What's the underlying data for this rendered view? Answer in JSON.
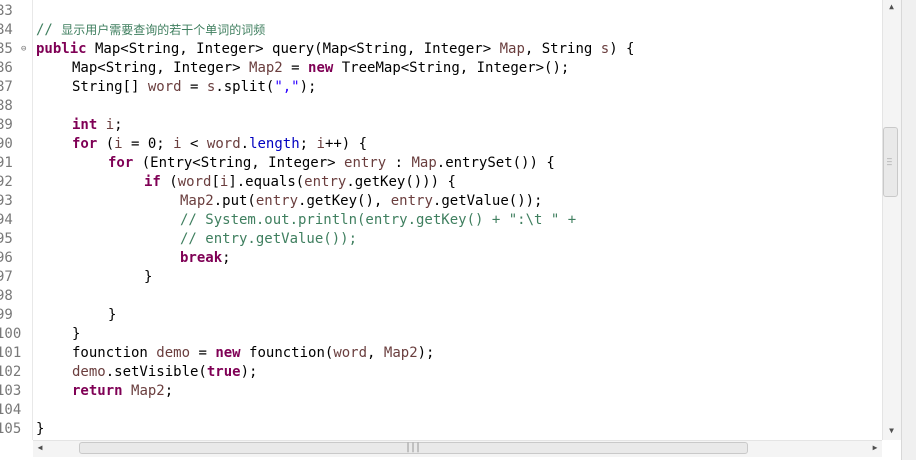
{
  "gutter": {
    "line_numbers": [
      "83",
      "84",
      "85",
      "86",
      "87",
      "88",
      "89",
      "90",
      "91",
      "92",
      "93",
      "94",
      "95",
      "96",
      "97",
      "98",
      "99",
      "100",
      "101",
      "102",
      "103",
      "104",
      "105"
    ],
    "fold_marker_line": 2
  },
  "code": {
    "lines": [
      {
        "indent": 0,
        "tokens": []
      },
      {
        "indent": 0,
        "tokens": [
          {
            "t": "// ",
            "c": "cm"
          },
          {
            "t": "显示用户需要查询的若干个单词的词频",
            "c": "cm cm-cn"
          }
        ]
      },
      {
        "indent": 0,
        "tokens": [
          {
            "t": "public",
            "c": "kw"
          },
          {
            "t": " Map<String, Integer> query(Map<String, Integer> "
          },
          {
            "t": "Map",
            "c": "lv"
          },
          {
            "t": ", String "
          },
          {
            "t": "s",
            "c": "lv"
          },
          {
            "t": ") {"
          }
        ]
      },
      {
        "indent": 1,
        "tokens": [
          {
            "t": "Map<String, Integer> "
          },
          {
            "t": "Map2",
            "c": "lv"
          },
          {
            "t": " = "
          },
          {
            "t": "new",
            "c": "kw"
          },
          {
            "t": " TreeMap<String, Integer>();"
          }
        ]
      },
      {
        "indent": 1,
        "tokens": [
          {
            "t": "String[] "
          },
          {
            "t": "word",
            "c": "lv"
          },
          {
            "t": " = "
          },
          {
            "t": "s",
            "c": "lv"
          },
          {
            "t": ".split("
          },
          {
            "t": "\",\"",
            "c": "str"
          },
          {
            "t": ");"
          }
        ]
      },
      {
        "indent": 0,
        "tokens": []
      },
      {
        "indent": 1,
        "tokens": [
          {
            "t": "int",
            "c": "kw"
          },
          {
            "t": " "
          },
          {
            "t": "i",
            "c": "lv"
          },
          {
            "t": ";"
          }
        ]
      },
      {
        "indent": 1,
        "tokens": [
          {
            "t": "for",
            "c": "kw"
          },
          {
            "t": " ("
          },
          {
            "t": "i",
            "c": "lv"
          },
          {
            "t": " = 0; "
          },
          {
            "t": "i",
            "c": "lv"
          },
          {
            "t": " < "
          },
          {
            "t": "word",
            "c": "lv"
          },
          {
            "t": "."
          },
          {
            "t": "length",
            "c": "fld"
          },
          {
            "t": "; "
          },
          {
            "t": "i",
            "c": "lv"
          },
          {
            "t": "++) {"
          }
        ]
      },
      {
        "indent": 2,
        "tokens": [
          {
            "t": "for",
            "c": "kw"
          },
          {
            "t": " (Entry<String, Integer> "
          },
          {
            "t": "entry",
            "c": "lv"
          },
          {
            "t": " : "
          },
          {
            "t": "Map",
            "c": "lv"
          },
          {
            "t": ".entrySet()) {"
          }
        ]
      },
      {
        "indent": 3,
        "tokens": [
          {
            "t": "if",
            "c": "kw"
          },
          {
            "t": " ("
          },
          {
            "t": "word",
            "c": "lv"
          },
          {
            "t": "["
          },
          {
            "t": "i",
            "c": "lv"
          },
          {
            "t": "].equals("
          },
          {
            "t": "entry",
            "c": "lv"
          },
          {
            "t": ".getKey())) {"
          }
        ]
      },
      {
        "indent": 4,
        "tokens": [
          {
            "t": "Map2",
            "c": "lv"
          },
          {
            "t": ".put("
          },
          {
            "t": "entry",
            "c": "lv"
          },
          {
            "t": ".getKey(), "
          },
          {
            "t": "entry",
            "c": "lv"
          },
          {
            "t": ".getValue());"
          }
        ]
      },
      {
        "indent": 4,
        "tokens": [
          {
            "t": "// System.out.println(entry.getKey() + \":\\t \" +",
            "c": "cm"
          }
        ]
      },
      {
        "indent": 4,
        "tokens": [
          {
            "t": "// entry.getValue());",
            "c": "cm"
          }
        ]
      },
      {
        "indent": 4,
        "tokens": [
          {
            "t": "break",
            "c": "kw"
          },
          {
            "t": ";"
          }
        ]
      },
      {
        "indent": 3,
        "tokens": [
          {
            "t": "}"
          }
        ]
      },
      {
        "indent": 0,
        "tokens": []
      },
      {
        "indent": 2,
        "tokens": [
          {
            "t": "}"
          }
        ]
      },
      {
        "indent": 1,
        "tokens": [
          {
            "t": "}"
          }
        ]
      },
      {
        "indent": 1,
        "tokens": [
          {
            "t": "founction "
          },
          {
            "t": "demo",
            "c": "lv"
          },
          {
            "t": " = "
          },
          {
            "t": "new",
            "c": "kw"
          },
          {
            "t": " founction("
          },
          {
            "t": "word",
            "c": "lv"
          },
          {
            "t": ", "
          },
          {
            "t": "Map2",
            "c": "lv"
          },
          {
            "t": ");"
          }
        ]
      },
      {
        "indent": 1,
        "tokens": [
          {
            "t": "demo",
            "c": "lv"
          },
          {
            "t": ".setVisible("
          },
          {
            "t": "true",
            "c": "kw"
          },
          {
            "t": ");"
          }
        ]
      },
      {
        "indent": 1,
        "tokens": [
          {
            "t": "return",
            "c": "kw"
          },
          {
            "t": " "
          },
          {
            "t": "Map2",
            "c": "lv"
          },
          {
            "t": ";"
          }
        ]
      },
      {
        "indent": 0,
        "tokens": []
      },
      {
        "indent": 0,
        "tokens": [
          {
            "t": "}"
          }
        ]
      }
    ]
  },
  "colors": {
    "keyword": "#7f0055",
    "comment": "#3f7f5f",
    "field": "#0000c0",
    "string": "#2a00ff",
    "local_variable": "#6a3e3e",
    "line_number": "#787878"
  },
  "scrollbars": {
    "vertical_position": 0.33,
    "horizontal_position": 0.06,
    "up_arrow": "▲",
    "down_arrow": "▼",
    "left_arrow": "◀",
    "right_arrow": "▶",
    "grip": "|||"
  }
}
